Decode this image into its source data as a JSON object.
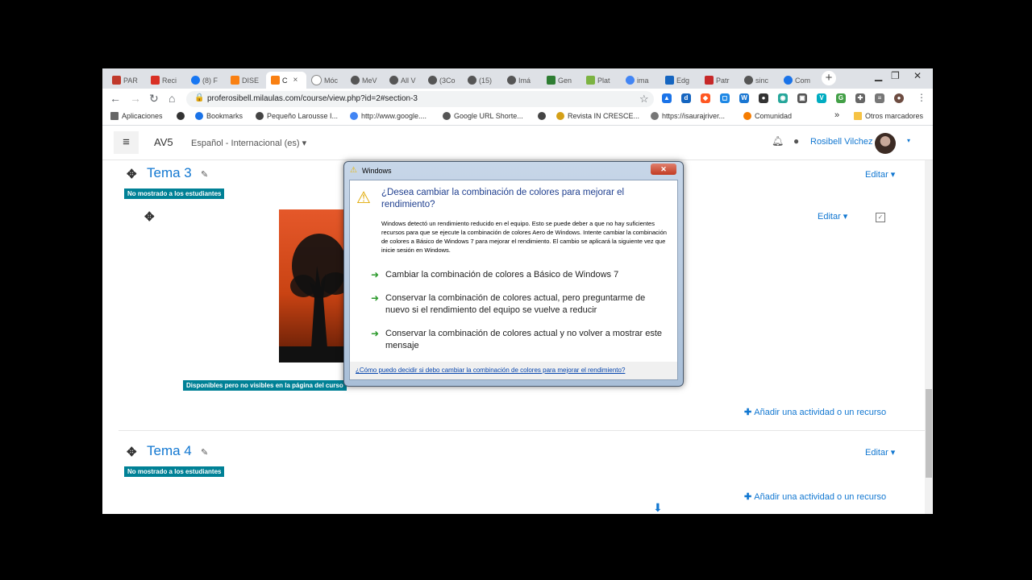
{
  "browser": {
    "tabs": [
      {
        "label": "PAR",
        "color": "#c0392b",
        "active": false
      },
      {
        "label": "Reci",
        "color": "#d93025",
        "active": false
      },
      {
        "label": "(8) F",
        "color": "#1877f2",
        "active": false
      },
      {
        "label": "DISE",
        "color": "#f98012",
        "active": false
      },
      {
        "label": "C",
        "color": "#f98012",
        "active": true
      },
      {
        "label": "Móc",
        "color": "#888888",
        "active": false
      },
      {
        "label": "MeV",
        "color": "#555555",
        "active": false
      },
      {
        "label": "All V",
        "color": "#555555",
        "active": false
      },
      {
        "label": "(3Co",
        "color": "#555555",
        "active": false
      },
      {
        "label": "(15)",
        "color": "#555555",
        "active": false
      },
      {
        "label": "Imá",
        "color": "#555555",
        "active": false
      },
      {
        "label": "Gen",
        "color": "#2e7d32",
        "active": false
      },
      {
        "label": "Plat",
        "color": "#7cb342",
        "active": false
      },
      {
        "label": "ima",
        "color": "#4285f4",
        "active": false
      },
      {
        "label": "Edg",
        "color": "#1565c0",
        "active": false
      },
      {
        "label": "Patr",
        "color": "#c62828",
        "active": false
      },
      {
        "label": "sinc",
        "color": "#555555",
        "active": false
      },
      {
        "label": "Com",
        "color": "#1a73e8",
        "active": false
      }
    ],
    "tab_close": "×",
    "new_tab": "+",
    "win_minimize": "▁",
    "win_restore": "❐",
    "win_close": "✕",
    "url": "proferosibell.milaulas.com/course/view.php?id=2#section-3",
    "bookmarks": [
      {
        "label": "Aplicaciones",
        "color": "#666666"
      },
      {
        "label": "Bookmarks",
        "color": "#1a73e8"
      },
      {
        "label": "Pequeño Larousse I...",
        "color": "#444444"
      },
      {
        "label": "http://www.google....",
        "color": "#4285f4"
      },
      {
        "label": "Google URL Shorte...",
        "color": "#555555"
      },
      {
        "label": "Revista IN CRESCE...",
        "color": "#d4a017"
      },
      {
        "label": "https://isaurajriver...",
        "color": "#777777"
      },
      {
        "label": "Comunidad",
        "color": "#f57c00"
      }
    ],
    "bookmarks_more": "»",
    "other_bookmarks": "Otros marcadores"
  },
  "moodle": {
    "menu_icon": "≡",
    "site_name": "AV5",
    "language": "Español - Internacional (es) ▾",
    "user_name": "Rosibell Vilchez",
    "user_caret": "▾",
    "sections": [
      {
        "title": "Tema 3",
        "badge": "No mostrado a los estudiantes",
        "edit": "Editar ▾",
        "add": "Añadir una actividad o un recurso"
      },
      {
        "title": "Tema 4",
        "badge": "No mostrado a los estudiantes",
        "edit": "Editar ▾",
        "add": "Añadir una actividad o un recurso"
      }
    ],
    "activity_edit": "Editar ▾",
    "activity_badge": "Disponibles pero no visibles en la página del curso"
  },
  "dialog": {
    "title": "Windows",
    "close": "✕",
    "heading": "¿Desea cambiar la combinación de colores para mejorar el rendimiento?",
    "text": "Windows detectó un rendimiento reducido en el equipo. Esto se puede deber a que no hay suficientes recursos para que se ejecute la combinación de colores Aero de Windows. Intente cambiar la combinación de colores a Básico de Windows 7 para mejorar el rendimiento. El cambio se aplicará la siguiente vez que inicie sesión en Windows.",
    "options": [
      "Cambiar la combinación de colores a Básico de Windows 7",
      "Conservar la combinación de colores actual, pero preguntarme de nuevo si el rendimiento del equipo se vuelve a reducir",
      "Conservar la combinación de colores actual y no volver a mostrar este mensaje"
    ],
    "help_link": "¿Cómo puedo decidir si debo cambiar la combinación de colores para mejorar el rendimiento?"
  }
}
